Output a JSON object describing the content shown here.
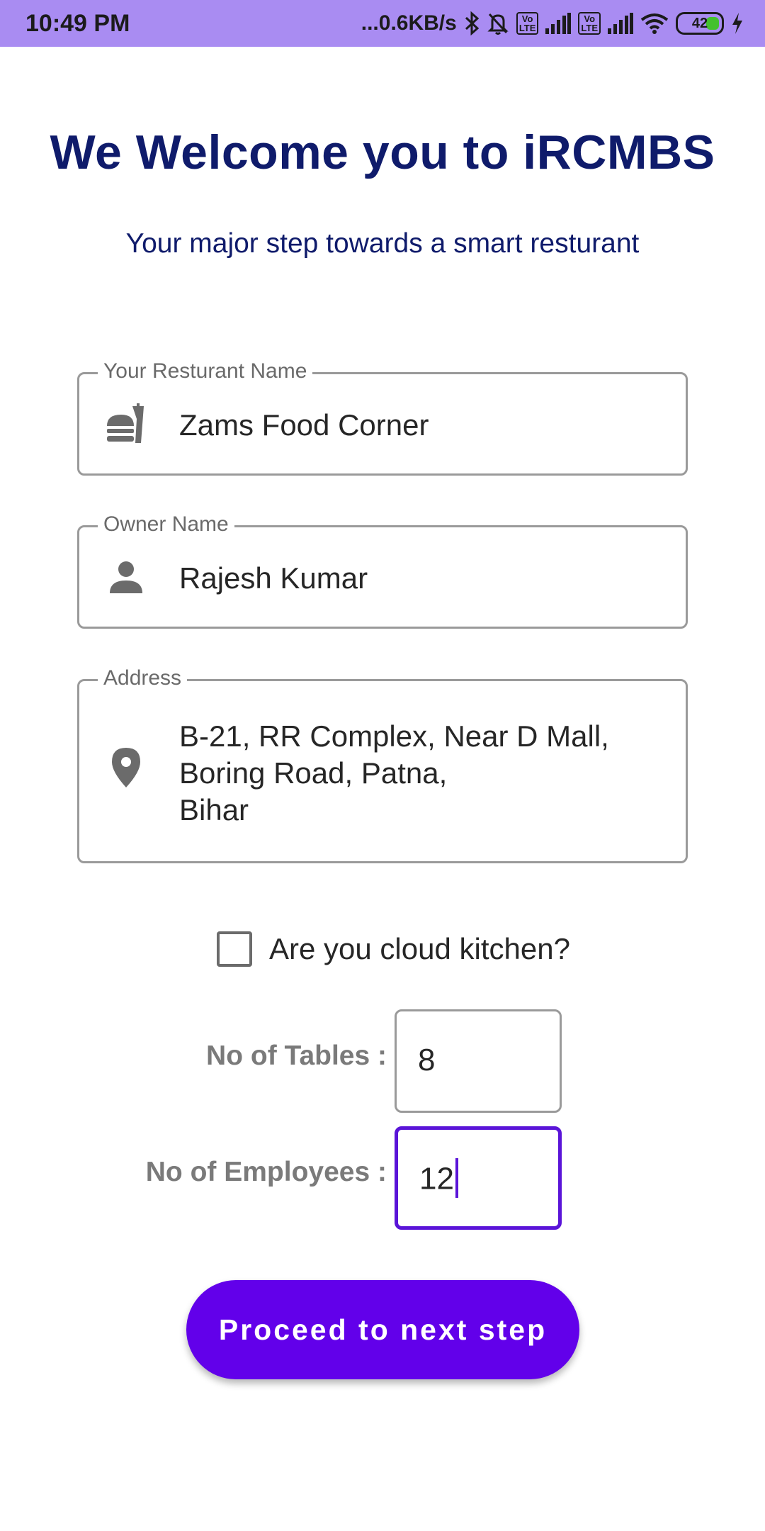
{
  "status_bar": {
    "time": "10:49 PM",
    "network_speed": "...0.6KB/s",
    "battery": "42",
    "icons": [
      "bluetooth-icon",
      "mute-bell-icon",
      "volte-icon",
      "signal-icon",
      "volte-icon",
      "signal-icon",
      "wifi-icon",
      "battery-icon",
      "charging-icon"
    ]
  },
  "header": {
    "title": "We Welcome you to iRCMBS",
    "subtitle": "Your major step towards a smart resturant"
  },
  "form": {
    "restaurant": {
      "label": "Your Resturant Name",
      "value": "Zams Food Corner",
      "icon": "fastfood-icon"
    },
    "owner": {
      "label": "Owner Name",
      "value": "Rajesh Kumar",
      "icon": "person-icon"
    },
    "address": {
      "label": "Address",
      "value": "B-21, RR Complex, Near D Mall,\nBoring Road, Patna,\nBihar",
      "icon": "location-pin-icon"
    },
    "cloud_kitchen": {
      "label": "Are you cloud kitchen?",
      "checked": false
    },
    "tables": {
      "label": "No of Tables :",
      "value": "8"
    },
    "employees": {
      "label": "No of Employees :",
      "value": "12"
    }
  },
  "actions": {
    "proceed_label": "Proceed to next step"
  },
  "colors": {
    "status_bar": "#a98cf2",
    "heading": "#0f1b6b",
    "accent": "#6200ea",
    "field_border": "#9a9a9a"
  }
}
